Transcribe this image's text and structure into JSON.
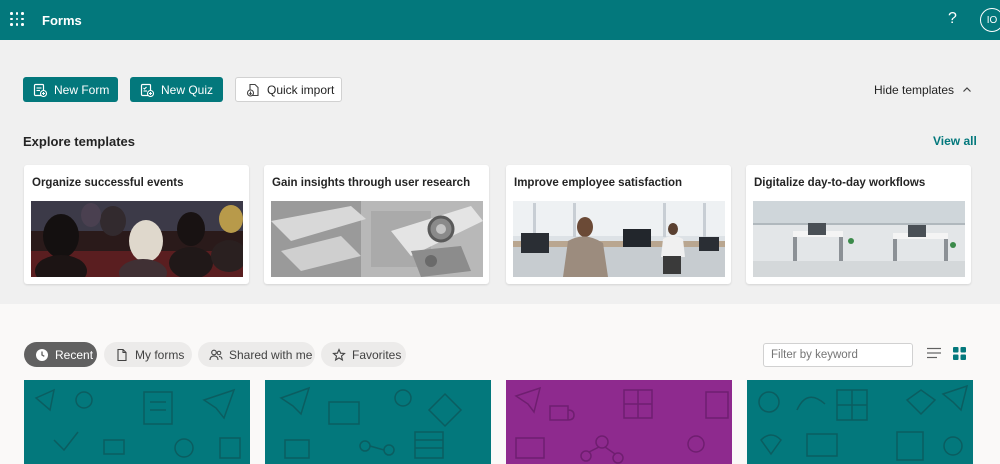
{
  "header": {
    "app_title": "Forms",
    "help_label": "?",
    "avatar_initials": "IO",
    "bar_color": "#03787c"
  },
  "actions": {
    "new_form": "New Form",
    "new_quiz": "New Quiz",
    "quick_import": "Quick import",
    "hide_templates": "Hide templates"
  },
  "templates": {
    "heading": "Explore templates",
    "view_all": "View all",
    "cards": [
      {
        "title": "Organize successful events",
        "image": "audience-photo"
      },
      {
        "title": "Gain insights through user research",
        "image": "machine-parts-photo"
      },
      {
        "title": "Improve employee satisfaction",
        "image": "office-worker-photo"
      },
      {
        "title": "Digitalize day-to-day workflows",
        "image": "office-interior-photo"
      }
    ]
  },
  "tabs": [
    {
      "label": "Recent",
      "icon": "clock-icon",
      "active": true
    },
    {
      "label": "My forms",
      "icon": "document-icon",
      "active": false
    },
    {
      "label": "Shared with me",
      "icon": "people-icon",
      "active": false
    },
    {
      "label": "Favorites",
      "icon": "star-icon",
      "active": false
    }
  ],
  "filter": {
    "placeholder": "Filter by keyword"
  },
  "form_cards": [
    {
      "color": "#03787c"
    },
    {
      "color": "#03787c"
    },
    {
      "color": "#8e2a8e"
    },
    {
      "color": "#03787c"
    }
  ]
}
